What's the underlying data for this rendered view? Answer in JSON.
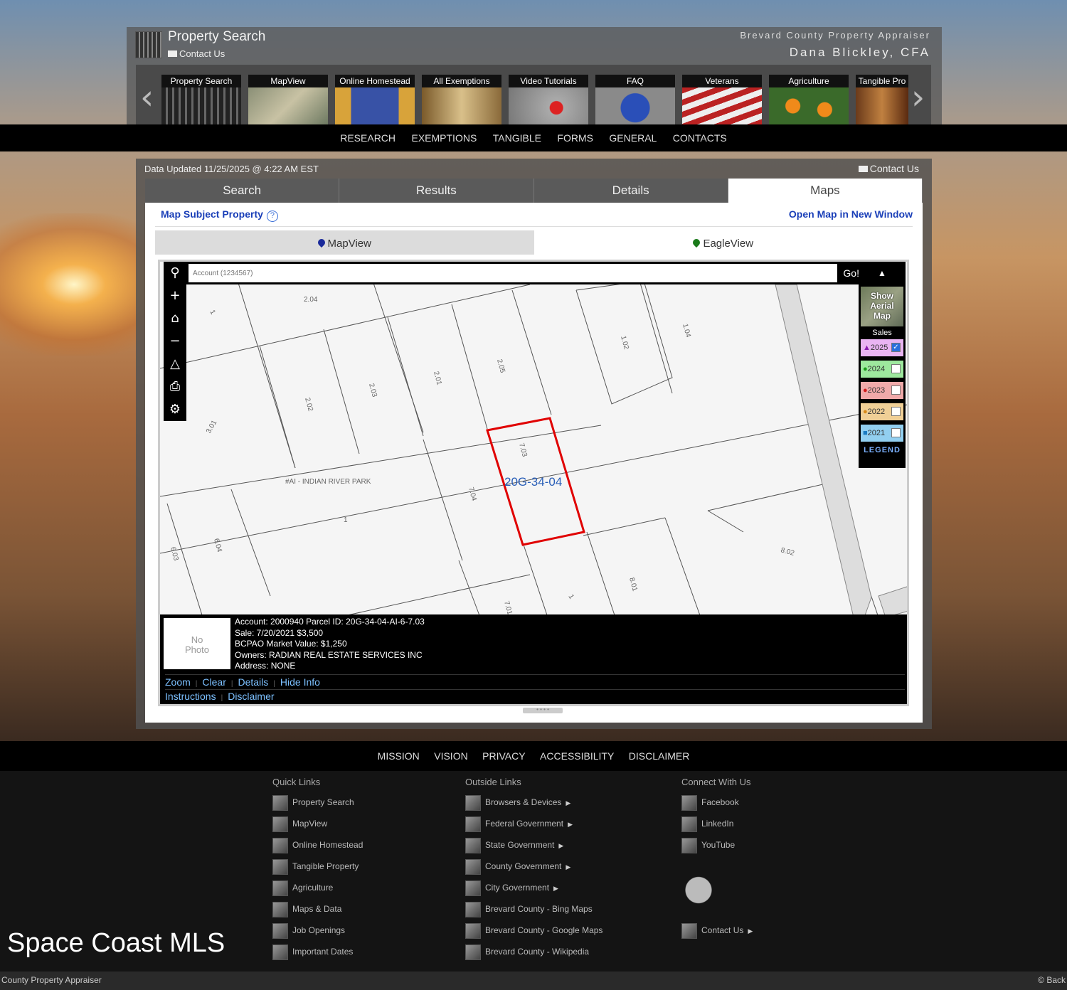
{
  "header": {
    "title": "Property Search",
    "contact": "Contact Us",
    "office": "Brevard County Property Appraiser",
    "appraiser": "Dana Blickley, CFA"
  },
  "carousel": {
    "prev": "‹",
    "next": "›",
    "items": [
      "Property Search",
      "MapView",
      "Online Homestead",
      "All Exemptions",
      "Video Tutorials",
      "FAQ",
      "Veterans",
      "Agriculture",
      "Tangible Pro"
    ]
  },
  "nav": [
    "RESEARCH",
    "EXEMPTIONS",
    "TANGIBLE",
    "FORMS",
    "GENERAL",
    "CONTACTS"
  ],
  "panel": {
    "updated": "Data Updated 11/25/2025 @ 4:22 AM EST",
    "contact": "Contact Us",
    "tabs": [
      "Search",
      "Results",
      "Details",
      "Maps"
    ],
    "active_tab": "Maps",
    "map_subject": "Map Subject Property",
    "open_map": "Open Map in New Window",
    "subtabs": [
      "MapView",
      "EagleView"
    ]
  },
  "map": {
    "search_placeholder": "Account (1234567)",
    "go": "Go!",
    "aerial": [
      "Show",
      "Aerial",
      "Map"
    ],
    "sales_label": "Sales",
    "sales_years": [
      {
        "year": "2025",
        "checked": true,
        "color": "#e9b4f2",
        "marker": "▲"
      },
      {
        "year": "2024",
        "checked": false,
        "color": "#9de89d",
        "marker": "●"
      },
      {
        "year": "2023",
        "checked": false,
        "color": "#f0a9a9",
        "marker": "●"
      },
      {
        "year": "2022",
        "checked": false,
        "color": "#f0cf96",
        "marker": "●"
      },
      {
        "year": "2021",
        "checked": false,
        "color": "#92cff0",
        "marker": "■"
      }
    ],
    "legend": "LEGEND",
    "subject_label": "20G-34-04",
    "subdivision": "#AI - INDIAN RIVER PARK",
    "lot_labels": [
      "2.04",
      "1",
      "2.02",
      "2.03",
      "2.01",
      "2.05",
      "1.02",
      "1.04",
      "3.01",
      "7.03",
      "7.04",
      "1",
      "6.04",
      "6.03",
      "7.01",
      "1",
      "8.01",
      "8.02"
    ]
  },
  "info": {
    "photo": [
      "No",
      "Photo"
    ],
    "line1": "Account: 2000940  Parcel ID: 20G-34-04-AI-6-7.03",
    "line2": "Sale: 7/20/2021 $3,500",
    "line3": "BCPAO Market Value: $1,250",
    "line4": "Owners: RADIAN REAL ESTATE SERVICES INC",
    "line5": "Address: NONE",
    "links_row1": [
      "Zoom",
      "Clear",
      "Details",
      "Hide Info"
    ],
    "links_row2": [
      "Instructions",
      "Disclaimer"
    ]
  },
  "footer_nav": [
    "MISSION",
    "VISION",
    "PRIVACY",
    "ACCESSIBILITY",
    "DISCLAIMER"
  ],
  "footer": {
    "quick_links_title": "Quick Links",
    "quick_links": [
      "Property Search",
      "MapView",
      "Online Homestead",
      "Tangible Property",
      "Agriculture",
      "Maps & Data",
      "Job Openings",
      "Important Dates"
    ],
    "outside_links_title": "Outside Links",
    "outside_links": [
      "Browsers & Devices",
      "Federal Government",
      "State Government",
      "County Government",
      "City Government",
      "Brevard County - Bing Maps",
      "Brevard County - Google Maps",
      "Brevard County - Wikipedia"
    ],
    "connect_title": "Connect With Us",
    "connect": [
      "Facebook",
      "LinkedIn",
      "YouTube"
    ],
    "contact": "Contact Us"
  },
  "watermark": "Space Coast MLS",
  "bottom_left": "County Property Appraiser",
  "bottom_right": "© Back"
}
